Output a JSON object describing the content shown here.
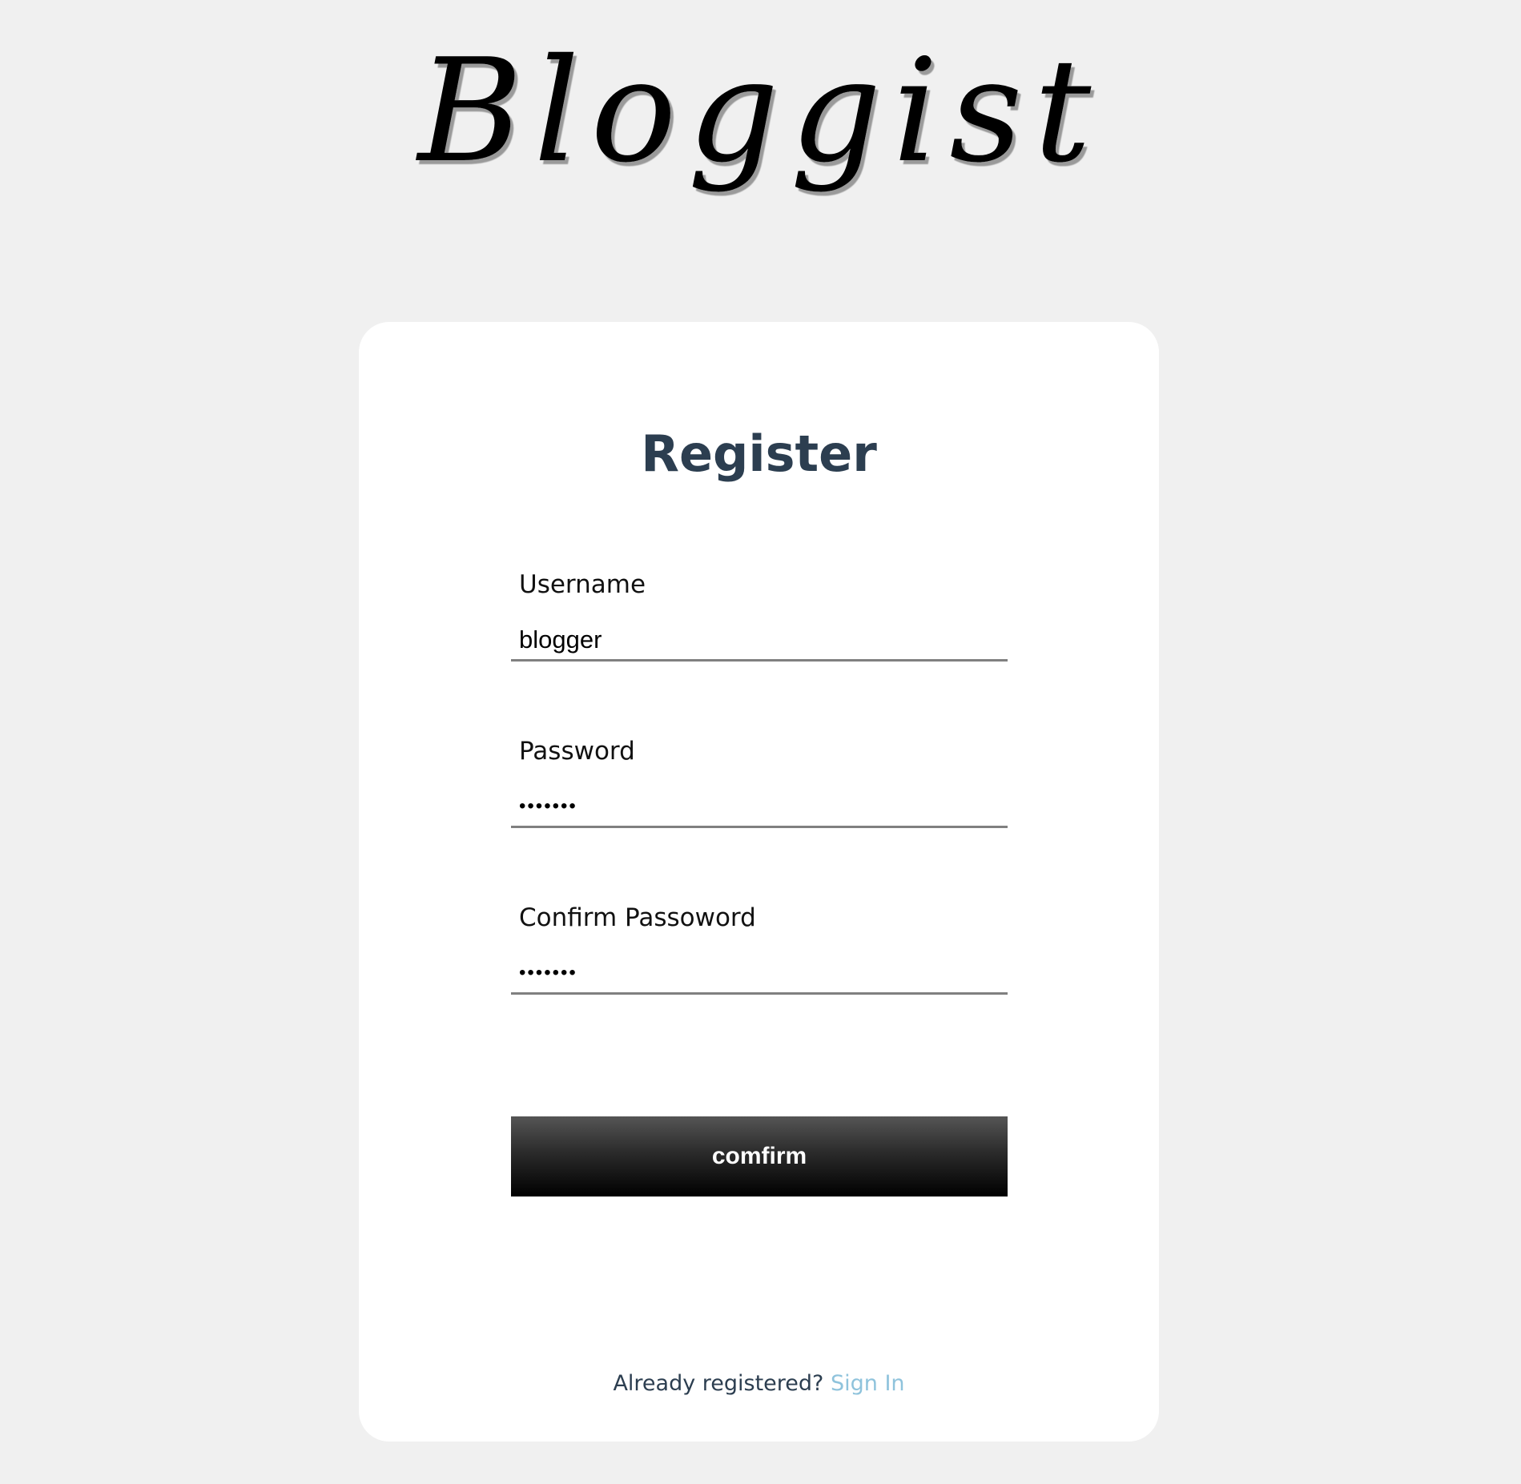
{
  "logo": {
    "text": "Bloggist"
  },
  "form": {
    "title": "Register",
    "username": {
      "label": "Username",
      "value": "blogger"
    },
    "password": {
      "label": "Password",
      "value": "•••••••"
    },
    "confirm_password": {
      "label": "Confirm Passoword",
      "value": "•••••••"
    },
    "submit_label": "comfirm"
  },
  "footer": {
    "prompt": "Already registered?",
    "link_label": "Sign In"
  },
  "colors": {
    "page_background": "#f0f0f0",
    "card_background": "#ffffff",
    "title": "#2c3e50",
    "link": "#8fc3dc",
    "input_underline": "#808080"
  }
}
